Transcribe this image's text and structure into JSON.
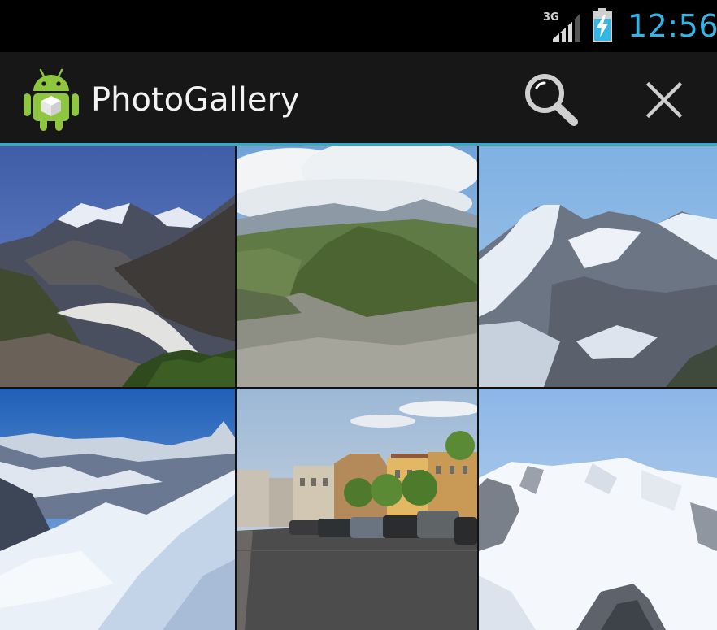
{
  "status_bar": {
    "network": "3G",
    "time": "12:56"
  },
  "action_bar": {
    "title": "PhotoGallery",
    "actions": [
      {
        "name": "search",
        "icon": "search-icon"
      },
      {
        "name": "close",
        "icon": "close-icon"
      }
    ]
  },
  "colors": {
    "accent": "#33b5e5",
    "action_bar_bg": "#171717",
    "status_bar_bg": "#000000"
  },
  "gallery": {
    "items": [
      {
        "subject": "glacier valley"
      },
      {
        "subject": "green mountain valley"
      },
      {
        "subject": "rocky snowy peaks"
      },
      {
        "subject": "snowy ridge"
      },
      {
        "subject": "town street with parked cars"
      },
      {
        "subject": "snow covered summit"
      }
    ]
  }
}
